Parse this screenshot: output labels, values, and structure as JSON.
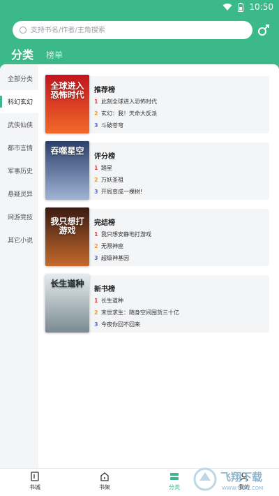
{
  "status": {
    "time": "10:50"
  },
  "search": {
    "placeholder": "支持书名/作者/主角搜索"
  },
  "tabs": {
    "active": "分类",
    "inactive": "榜单"
  },
  "sidebar": {
    "items": [
      {
        "label": "全部分类",
        "active": false
      },
      {
        "label": "科幻玄幻",
        "active": true
      },
      {
        "label": "武侠仙侠",
        "active": false
      },
      {
        "label": "都市言情",
        "active": false
      },
      {
        "label": "军事历史",
        "active": false
      },
      {
        "label": "悬疑灵异",
        "active": false
      },
      {
        "label": "网游竞技",
        "active": false
      },
      {
        "label": "其它小说",
        "active": false
      }
    ]
  },
  "rankings": [
    {
      "title": "推荐榜",
      "cover_title": "全球进入恐怖时代",
      "cover_colors": [
        "#c2151e",
        "#f26a2a"
      ],
      "items": [
        {
          "rank": "1",
          "name": "此刻全球进入恐怖时代"
        },
        {
          "rank": "2",
          "name": "玄幻：我！天命大反派"
        },
        {
          "rank": "3",
          "name": "斗破苍穹"
        }
      ]
    },
    {
      "title": "评分榜",
      "cover_title": "吞噬星空",
      "cover_colors": [
        "#2b3f6a",
        "#9fb4d6"
      ],
      "items": [
        {
          "rank": "1",
          "name": "踏星"
        },
        {
          "rank": "2",
          "name": "万妖圣祖"
        },
        {
          "rank": "3",
          "name": "开局变成一棵树!"
        }
      ]
    },
    {
      "title": "完结榜",
      "cover_title": "我只想打游戏",
      "cover_colors": [
        "#3a1a12",
        "#c46a2c"
      ],
      "items": [
        {
          "rank": "1",
          "name": "我只想安静地打游戏"
        },
        {
          "rank": "2",
          "name": "无限神座"
        },
        {
          "rank": "3",
          "name": "超级神基因"
        }
      ]
    },
    {
      "title": "新书榜",
      "cover_title": "长生道种",
      "cover_colors": [
        "#e6ecee",
        "#7a8a92"
      ],
      "items": [
        {
          "rank": "1",
          "name": "长生道种"
        },
        {
          "rank": "2",
          "name": "末世求生：随身空间囤货三十亿"
        },
        {
          "rank": "3",
          "name": "今夜你回不回来"
        }
      ]
    }
  ],
  "bottom_nav": [
    {
      "label": "书城",
      "icon": "book-city-icon",
      "active": false
    },
    {
      "label": "书架",
      "icon": "bookshelf-icon",
      "active": false
    },
    {
      "label": "分类",
      "icon": "category-icon",
      "active": true
    },
    {
      "label": "我的",
      "icon": "profile-icon",
      "active": false
    }
  ],
  "colors": {
    "brand": "#3cb98a",
    "rank1": "#e8443a",
    "rank2": "#f09a2b",
    "rank3": "#5a73c9"
  },
  "watermark": {
    "text": "飞翔下载",
    "sub": "WWW.FXXZ.COM"
  }
}
